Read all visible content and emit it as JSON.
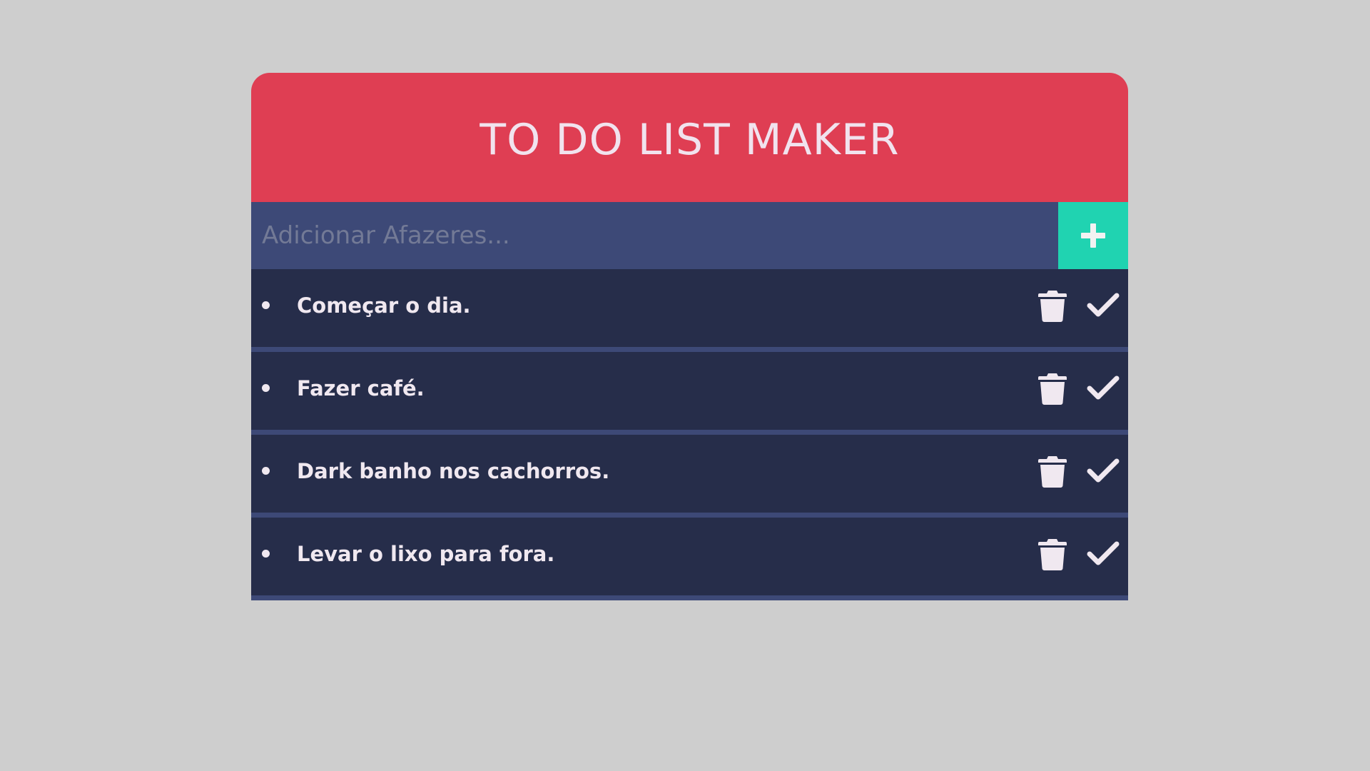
{
  "header": {
    "title": "TO DO LIST MAKER"
  },
  "input": {
    "placeholder": "Adicionar Afazeres...",
    "value": "",
    "add_icon": "plus-icon"
  },
  "todos": [
    {
      "text": "Começar o dia.",
      "delete_icon": "trash-icon",
      "complete_icon": "check-icon"
    },
    {
      "text": "Fazer café.",
      "delete_icon": "trash-icon",
      "complete_icon": "check-icon"
    },
    {
      "text": "Dark banho nos cachorros.",
      "delete_icon": "trash-icon",
      "complete_icon": "check-icon"
    },
    {
      "text": "Levar o lixo para fora.",
      "delete_icon": "trash-icon",
      "complete_icon": "check-icon"
    }
  ],
  "colors": {
    "background": "#cecece",
    "header": "#df3e53",
    "input_bar": "#3d4977",
    "add_button": "#20d3b1",
    "item_background": "#262d4a",
    "item_separator": "#3d4977",
    "text_light": "#f0e8f0"
  }
}
